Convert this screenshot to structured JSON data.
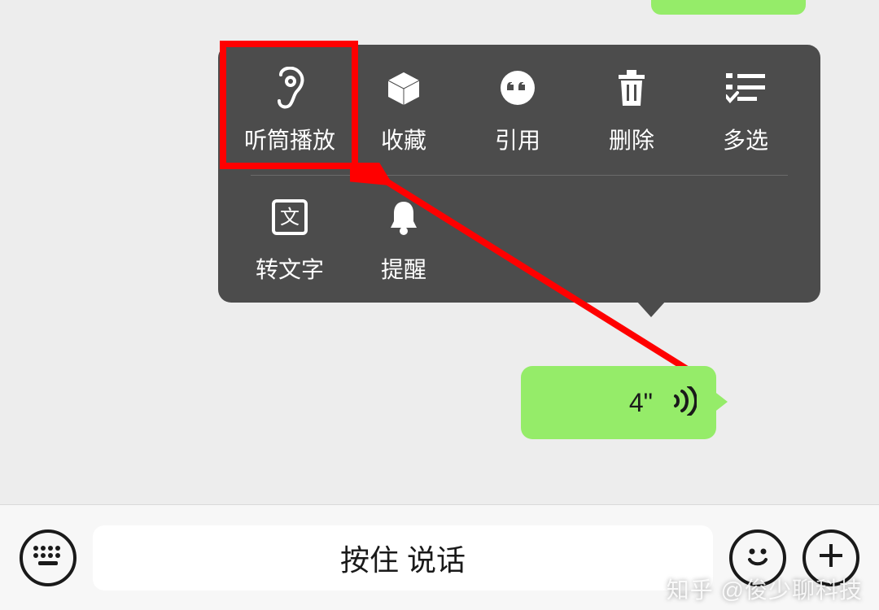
{
  "menu": {
    "row1": [
      {
        "key": "earpiece",
        "label": "听筒播放"
      },
      {
        "key": "favorite",
        "label": "收藏"
      },
      {
        "key": "quote",
        "label": "引用"
      },
      {
        "key": "delete",
        "label": "删除"
      },
      {
        "key": "multiselect",
        "label": "多选"
      }
    ],
    "row2": [
      {
        "key": "to_text",
        "label": "转文字"
      },
      {
        "key": "remind",
        "label": "提醒"
      }
    ]
  },
  "voice_message": {
    "duration_label": "4\""
  },
  "input_bar": {
    "placeholder": "按住 说话"
  },
  "watermark": "知乎 @俊少聊科技",
  "colors": {
    "bg": "#ededed",
    "menu_bg": "#4c4c4c",
    "bubble": "#95ec69",
    "highlight": "#ff0000"
  }
}
